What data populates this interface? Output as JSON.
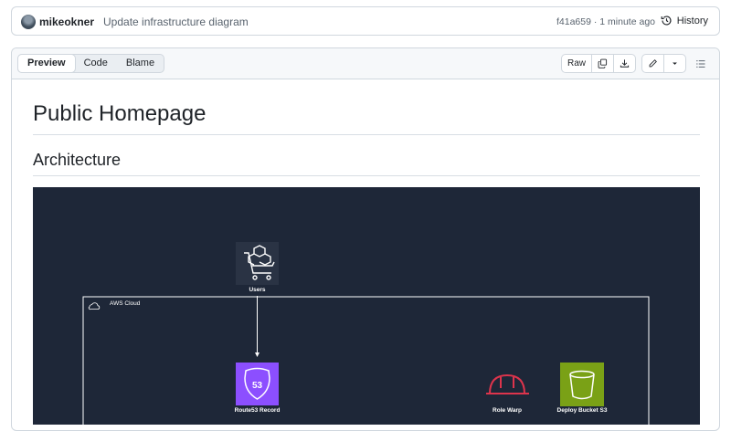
{
  "commit": {
    "author": "mikeokner",
    "message": "Update infrastructure diagram",
    "sha_time": "f41a659 · 1 minute ago",
    "history_label": "History"
  },
  "file_header": {
    "tabs": [
      {
        "label": "Preview",
        "active": true
      },
      {
        "label": "Code",
        "active": false
      },
      {
        "label": "Blame",
        "active": false
      }
    ],
    "raw_label": "Raw"
  },
  "content": {
    "h1": "Public Homepage",
    "h2": "Architecture"
  },
  "diagram": {
    "background": "#1e2738",
    "nodes": {
      "users": "Users",
      "aws_cloud": "AWS Cloud",
      "route53": "Route53 Record",
      "role": "Role Warp",
      "bucket": "Deploy Bucket S3"
    },
    "colors": {
      "route53": "#8c4fff",
      "s3": "#7aa116",
      "role": "#dd344c",
      "users_tile": "#2a3344"
    }
  }
}
